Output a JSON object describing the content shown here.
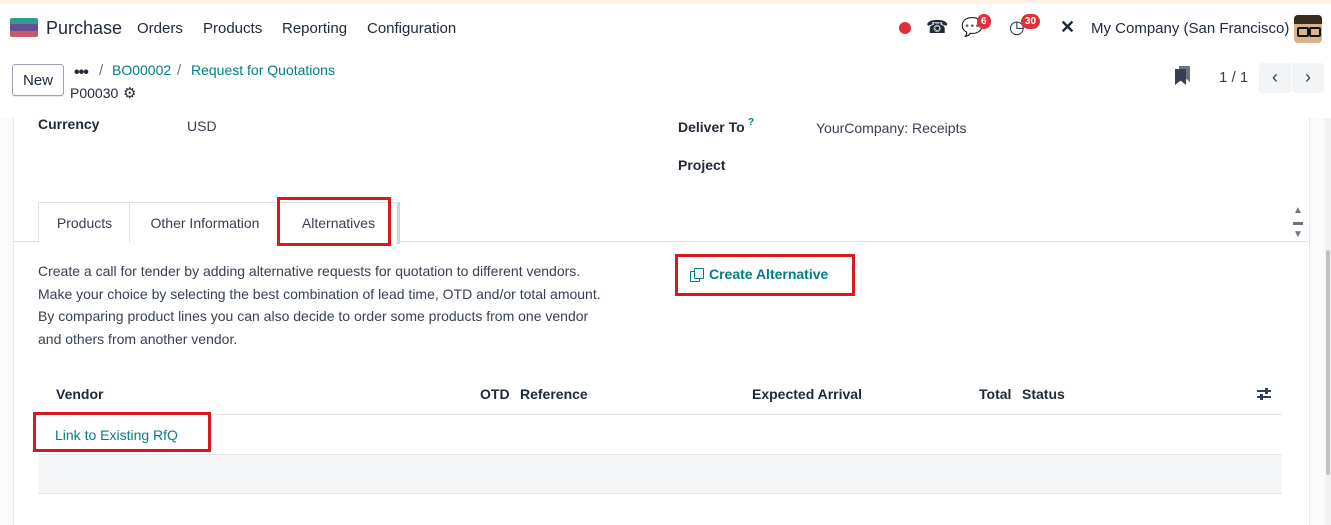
{
  "navbar": {
    "app_name": "Purchase",
    "menu": [
      "Orders",
      "Products",
      "Reporting",
      "Configuration"
    ],
    "messages_count": "6",
    "activities_count": "30",
    "company": "My Company (San Francisco)"
  },
  "control": {
    "new_label": "New",
    "breadcrumbs": [
      "BO00002",
      "Request for Quotations"
    ],
    "record_name": "P00030",
    "pager": "1 / 1"
  },
  "form": {
    "currency_label": "Currency",
    "currency_value": "USD",
    "deliver_to_label": "Deliver To",
    "deliver_to_help": "?",
    "deliver_to_value": "YourCompany: Receipts",
    "project_label": "Project"
  },
  "tabs": [
    "Products",
    "Other Information",
    "Alternatives"
  ],
  "alternatives": {
    "description": [
      "Create a call for tender by adding alternative requests for quotation to different vendors.",
      "Make your choice by selecting the best combination of lead time, OTD and/or total amount.",
      "By comparing product lines you can also decide to order some products from one vendor",
      "and others from another vendor."
    ],
    "create_button": "Create Alternative",
    "columns": [
      "Vendor",
      "OTD",
      "Reference",
      "Expected Arrival",
      "Total",
      "Status"
    ],
    "link_existing": "Link to Existing RfQ"
  },
  "colors": {
    "accent": "#017e84",
    "highlight_box": "#d7191f",
    "badge": "#e0303a"
  }
}
